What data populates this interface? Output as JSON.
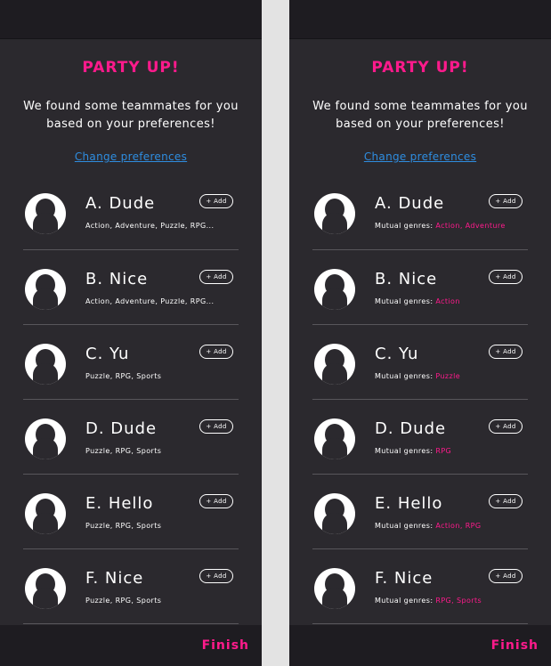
{
  "screens": [
    {
      "title": "PARTY UP!",
      "subtitle_line1": "We found some teammates for you",
      "subtitle_line2": "based on your preferences!",
      "change_preferences": "Change preferences",
      "add_label": "+ Add",
      "finish_label": "Finish",
      "teammates": [
        {
          "name": "A. Dude",
          "genres": "Action, Adventure, Puzzle, RPG..."
        },
        {
          "name": "B. Nice",
          "genres": "Action, Adventure, Puzzle, RPG..."
        },
        {
          "name": "C. Yu",
          "genres": "Puzzle, RPG, Sports"
        },
        {
          "name": "D. Dude",
          "genres": "Puzzle, RPG, Sports"
        },
        {
          "name": "E. Hello",
          "genres": "Puzzle, RPG, Sports"
        },
        {
          "name": "F. Nice",
          "genres": "Puzzle, RPG, Sports"
        }
      ]
    },
    {
      "title": "PARTY UP!",
      "subtitle_line1": "We found some teammates for you",
      "subtitle_line2": "based on your preferences!",
      "change_preferences": "Change preferences",
      "add_label": "+ Add",
      "finish_label": "Finish",
      "mutual_label": "Mutual genres: ",
      "teammates": [
        {
          "name": "A. Dude",
          "mutual": "Action, Adventure"
        },
        {
          "name": "B. Nice",
          "mutual": "Action"
        },
        {
          "name": "C. Yu",
          "mutual": "Puzzle"
        },
        {
          "name": "D. Dude",
          "mutual": "RPG"
        },
        {
          "name": "E. Hello",
          "mutual": "Action, RPG"
        },
        {
          "name": "F. Nice",
          "mutual": "RPG, Sports"
        }
      ]
    }
  ],
  "colors": {
    "accent": "#ff1a8c",
    "link": "#2e8de0",
    "panel_bg": "#2b292e",
    "bar_bg": "#1e1c21",
    "gutter": "#e3e3e3"
  }
}
